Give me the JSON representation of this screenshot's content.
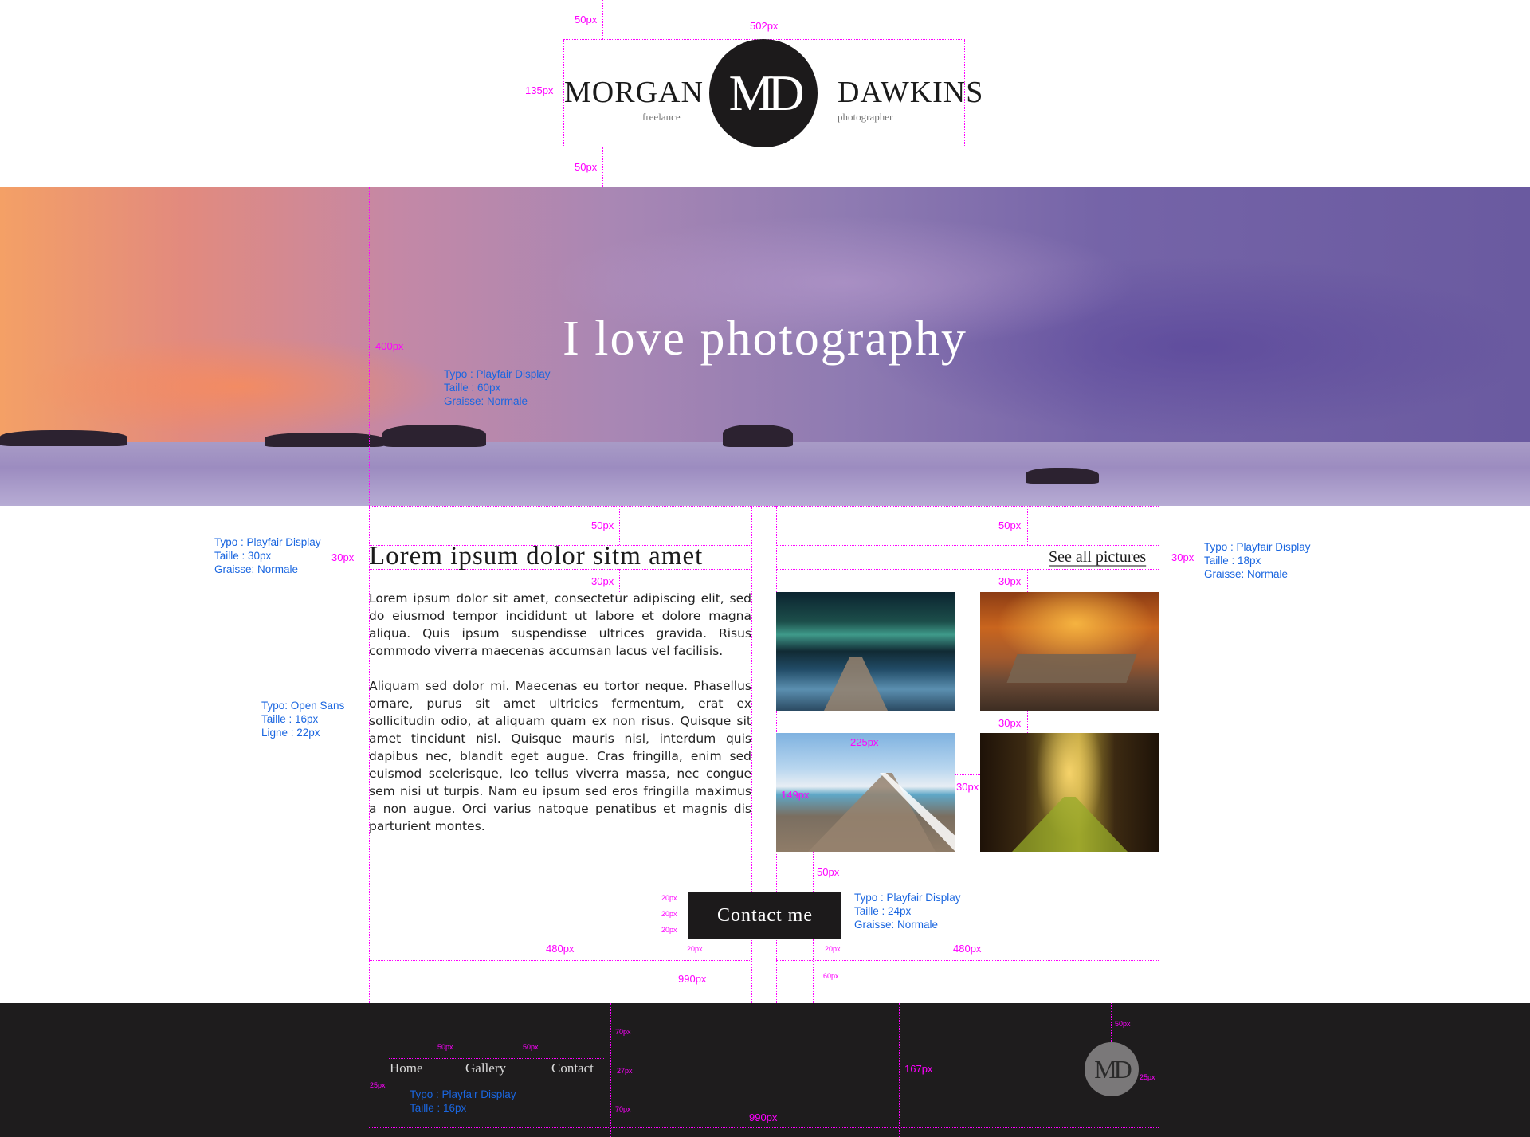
{
  "header": {
    "first_name": "MORGAN",
    "first_sub": "freelance",
    "monogram": "MD",
    "last_name": "DAWKINS",
    "last_sub": "photographer"
  },
  "hero": {
    "title": "I love photography"
  },
  "content": {
    "title": "Lorem ipsum dolor sitm amet",
    "paragraph_1": "Lorem ipsum dolor sit amet, consectetur adipiscing elit, sed do eiusmod tempor incididunt ut labore et dolore magna aliqua. Quis ipsum suspendisse ultrices gravida. Risus commodo viverra maecenas accumsan lacus vel facilisis.",
    "paragraph_2": "Aliquam sed dolor mi. Maecenas eu tortor neque. Phasellus ornare, purus sit amet ultricies fermentum, erat ex sollicitudin odio, at aliquam quam ex non risus. Quisque sit amet tincidunt nisl. Quisque mauris nisl, interdum quis dapibus nec, blandit eget augue. Cras fringilla, enim sed euismod scelerisque, leo tellus viverra massa, nec congue sem nisi ut turpis. Nam eu ipsum sed eros fringilla maximus a non augue. Orci varius natoque penatibus et magnis dis parturient montes.",
    "see_all": "See all pictures",
    "contact_button": "Contact me"
  },
  "footer": {
    "nav": [
      "Home",
      "Gallery",
      "Contact"
    ],
    "monogram": "MD"
  },
  "annotations": {
    "m50a": "50px",
    "m502": "502px",
    "m135": "135px",
    "m50b": "50px",
    "m400": "400px",
    "hero_note": "Typo : Playfair Display\nTaille : 60px\nGraisse: Normale",
    "m50c": "50px",
    "m50d": "50px",
    "title_note": "Typo : Playfair Display\nTaille : 30px\nGraisse: Normale",
    "m30a": "30px",
    "m30b": "30px",
    "m30c": "30px",
    "seeall_note": "Typo : Playfair Display\nTaille : 18px\nGraisse: Normale",
    "m30d": "30px",
    "body_note": "Typo: Open Sans\nTaille : 16px\nLigne : 22px",
    "m30e": "30px",
    "m225": "225px",
    "m149": "149px",
    "m30f": "30px",
    "m50e": "50px",
    "btn_note": "Typo : Playfair Display\nTaille : 24px\nGraisse: Normale",
    "m20a": "20px",
    "m20b": "20px",
    "m20c": "20px",
    "m20d": "20px",
    "m20e": "20px",
    "m480a": "480px",
    "m480b": "480px",
    "m60": "60px",
    "m990a": "990px",
    "f50a": "50px",
    "f50b": "50px",
    "f70a": "70px",
    "f27": "27px",
    "f70b": "70px",
    "f25a": "25px",
    "f167": "167px",
    "f50c": "50px",
    "f25b": "25px",
    "nav_note": "Typo : Playfair Display\nTaille : 16px",
    "f990": "990px"
  }
}
